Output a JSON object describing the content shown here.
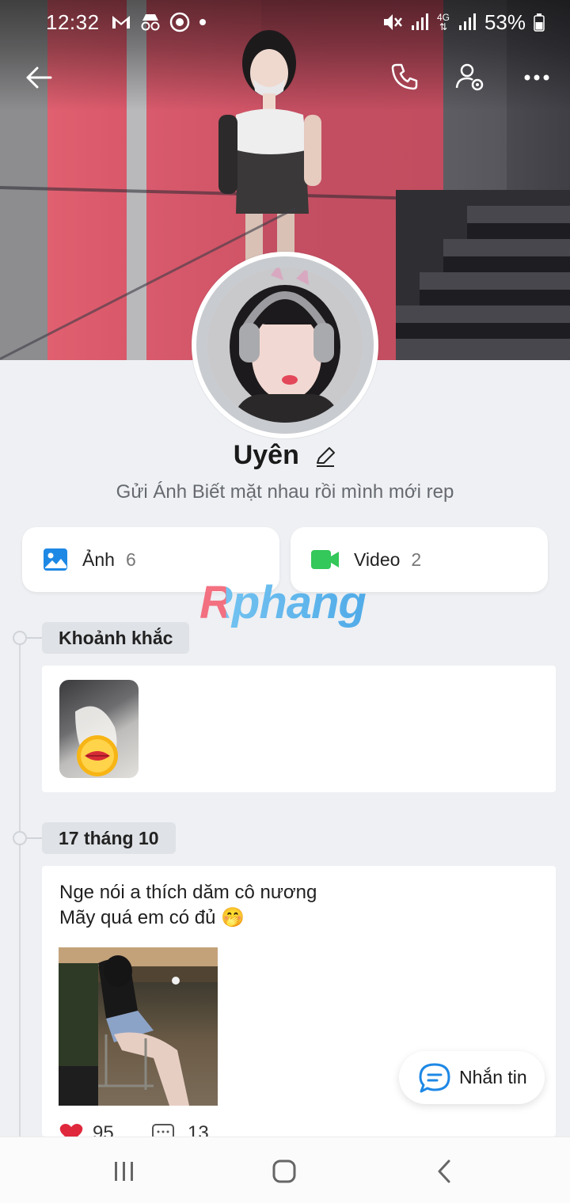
{
  "status_bar": {
    "time": "12:32",
    "network": "4G",
    "battery": "53%"
  },
  "profile": {
    "name": "Uyên",
    "status": "Gửi Ánh Biết mặt nhau rồi mình mới rep"
  },
  "media": {
    "photos_label": "Ảnh",
    "photos_count": "6",
    "videos_label": "Video",
    "videos_count": "2"
  },
  "watermark": "Rphang",
  "timeline": {
    "moments_label": "Khoảnh khắc",
    "post_date": "17 tháng 10",
    "post_line1": "Nge nói a thích dăm cô nương",
    "post_line2": "Mãy quá em có đủ 🤭",
    "likes": "95",
    "comments": "13"
  },
  "fab": {
    "label": "Nhắn tin"
  },
  "colors": {
    "accent": "#1e88e5",
    "video_green": "#34c759",
    "like_red": "#e0283c"
  }
}
